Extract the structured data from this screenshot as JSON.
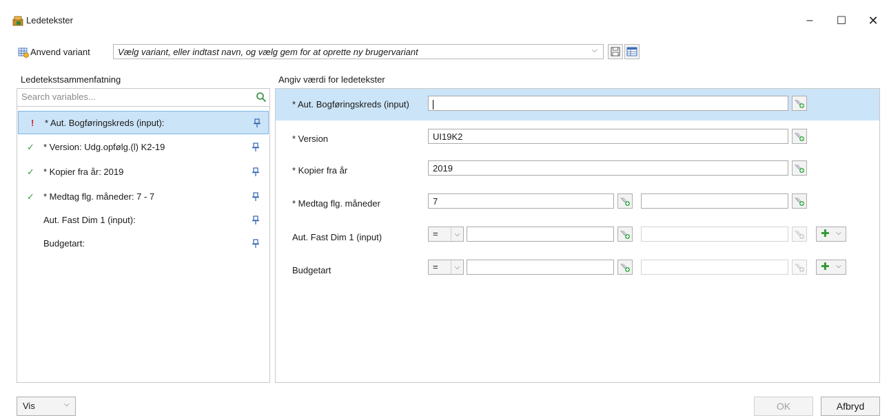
{
  "window": {
    "title": "Ledetekster",
    "minimize": "–",
    "maximize": "☐",
    "close": "✕"
  },
  "variant": {
    "label": "Anvend variant",
    "placeholder": "Vælg variant, eller indtast navn, og vælg gem for at oprette ny brugervariant"
  },
  "left_panel": {
    "header": "Ledetekstsammenfatning",
    "search_placeholder": "Search variables...",
    "items": [
      {
        "status": "!",
        "label": "* Aut. Bogføringskreds (input):"
      },
      {
        "status": "✓",
        "label": "* Version: Udg.opfølg.(l) K2-19"
      },
      {
        "status": "✓",
        "label": "* Kopier fra år: 2019"
      },
      {
        "status": "✓",
        "label": "* Medtag flg. måneder: 7 - 7"
      },
      {
        "status": "",
        "label": "Aut. Fast Dim 1 (input):"
      },
      {
        "status": "",
        "label": "Budgetart:"
      }
    ]
  },
  "right_panel": {
    "header": "Angiv værdi for ledetekster",
    "prompts": [
      {
        "label": "* Aut. Bogføringskreds (input)",
        "value": ""
      },
      {
        "label": "* Version",
        "value": "UI19K2"
      },
      {
        "label": "* Kopier fra år",
        "value": "2019"
      },
      {
        "label": "* Medtag flg. måneder",
        "from": "7",
        "to": ""
      },
      {
        "label": "Aut. Fast Dim 1 (input)",
        "operator": "=",
        "from": "",
        "to": ""
      },
      {
        "label": "Budgetart",
        "operator": "=",
        "from": "",
        "to": ""
      }
    ]
  },
  "footer": {
    "view_label": "Vis",
    "ok_label": "OK",
    "cancel_label": "Afbryd"
  },
  "colors": {
    "selection": "#cce4f7",
    "selection_border": "#7ab6e8",
    "warning": "#d32020",
    "ok_check": "#3a9a3a",
    "pin": "#3060b0"
  },
  "icons": {
    "app": "folder-box-icon",
    "variant": "variant-grid-icon",
    "save": "floppy-disk-icon",
    "table": "table-layout-icon",
    "search": "magnifier-icon",
    "pin": "pin-icon",
    "value_picker": "value-picker-icon",
    "add": "green-plus-icon"
  }
}
